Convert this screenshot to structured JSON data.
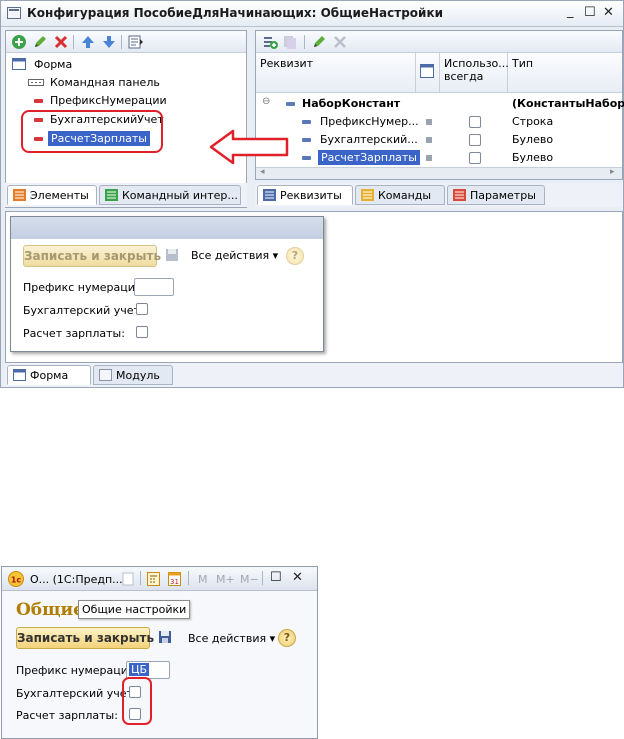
{
  "window1": {
    "title": "Конфигурация ПособиеДляНачинающих: ОбщиеНастройки",
    "controls": {
      "minimize": "_",
      "maximize": "☐",
      "close": "✕"
    }
  },
  "elements_pane": {
    "tree": [
      {
        "label": "Форма",
        "icon": "form-icon"
      },
      {
        "label": "Командная панель",
        "icon": "command-panel-icon"
      },
      {
        "label": "ПрефиксНумерации",
        "icon": "field-icon"
      },
      {
        "label": "БухгалтерскийУчет",
        "icon": "field-icon"
      },
      {
        "label": "РасчетЗарплаты",
        "icon": "field-icon",
        "selected": true
      }
    ],
    "tabs": [
      {
        "label": "Элементы",
        "active": true
      },
      {
        "label": "Командный интер..."
      }
    ]
  },
  "attributes_pane": {
    "columns": [
      "Реквизит",
      "Использо... всегда",
      "Тип"
    ],
    "rows": [
      {
        "name": "НаборКонстант",
        "type": "(КонстантыНабор)",
        "bold": true
      },
      {
        "name": "ПрефиксНумер...",
        "type": "Строка"
      },
      {
        "name": "Бухгалтерский...",
        "type": "Булево"
      },
      {
        "name": "РасчетЗарплаты",
        "type": "Булево",
        "selected": true
      }
    ],
    "tabs": [
      {
        "label": "Реквизиты",
        "active": true
      },
      {
        "label": "Команды"
      },
      {
        "label": "Параметры"
      }
    ]
  },
  "form_preview": {
    "save_close": "Записать и закрыть",
    "all_actions": "Все действия ▾",
    "help": "?",
    "fields": [
      {
        "label": "Префикс нумерации:"
      },
      {
        "label": "Бухгалтерский учет:"
      },
      {
        "label": "Расчет зарплаты:"
      }
    ]
  },
  "bottom_tabs": [
    {
      "label": "Форма",
      "active": true
    },
    {
      "label": "Модуль"
    }
  ],
  "window2": {
    "title": "О...  (1С:Предп...",
    "toolbar": {
      "m": "M",
      "m_plus": "M+",
      "m_minus": "M−",
      "maximize": "☐",
      "close": "✕"
    },
    "heading": "Общие",
    "tooltip": "Общие настройки",
    "save_close": "Записать и закрыть",
    "all_actions": "Все действия ▾",
    "help": "?",
    "prefix_label": "Префикс нумерации:",
    "prefix_value": "ЦБ",
    "accounting_label": "Бухгалтерский учет:",
    "salary_label": "Расчет зарплаты:"
  },
  "colors": {
    "highlight_red": "#e0202a",
    "selection": "#3a64c8",
    "accent_gold": "#b07d00"
  }
}
